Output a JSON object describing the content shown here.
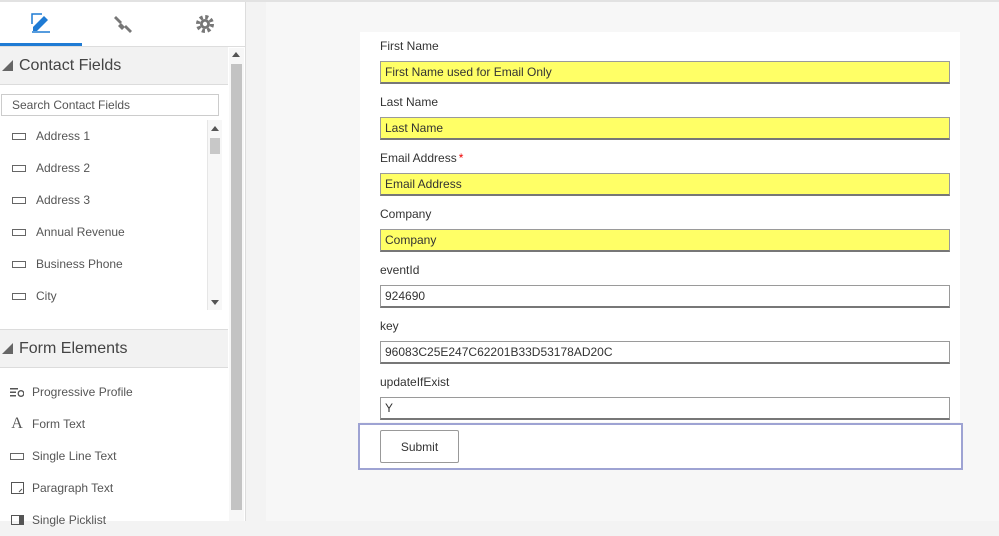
{
  "sidebar": {
    "tabs": [
      {
        "icon": "pencil-edit-icon",
        "active": true
      },
      {
        "icon": "paintbrush-icon",
        "active": false
      },
      {
        "icon": "gear-icon",
        "active": false
      }
    ],
    "contact_fields": {
      "title": "Contact Fields",
      "search_placeholder": "Search Contact Fields",
      "items": [
        "Address 1",
        "Address 2",
        "Address 3",
        "Annual Revenue",
        "Business Phone",
        "City"
      ]
    },
    "form_elements": {
      "title": "Form Elements",
      "items": [
        {
          "label": "Progressive Profile",
          "icon": "progressive-profile-icon"
        },
        {
          "label": "Form Text",
          "icon": "text-a-icon"
        },
        {
          "label": "Single Line Text",
          "icon": "single-line-icon"
        },
        {
          "label": "Paragraph Text",
          "icon": "paragraph-icon"
        },
        {
          "label": "Single Picklist",
          "icon": "picklist-icon"
        }
      ]
    }
  },
  "form": {
    "fields": [
      {
        "label": "First Name",
        "value": "First Name used for Email Only",
        "highlight": true,
        "required": false
      },
      {
        "label": "Last Name",
        "value": "Last Name",
        "highlight": true,
        "required": false
      },
      {
        "label": "Email Address",
        "value": "Email Address",
        "highlight": true,
        "required": true,
        "required_mark": "*"
      },
      {
        "label": "Company",
        "value": "Company",
        "highlight": true,
        "required": false
      },
      {
        "label": "eventId",
        "value": "924690",
        "highlight": false,
        "required": false
      },
      {
        "label": "key",
        "value": "96083C25E247C62201B33D53178AD20C",
        "highlight": false,
        "required": false
      },
      {
        "label": "updateIfExist",
        "value": "Y",
        "highlight": false,
        "required": false
      }
    ],
    "submit_label": "Submit"
  },
  "colors": {
    "accent": "#1f7bd4",
    "highlight": "#ffff66",
    "required": "#e00000",
    "selection": "#9ea3d3"
  }
}
